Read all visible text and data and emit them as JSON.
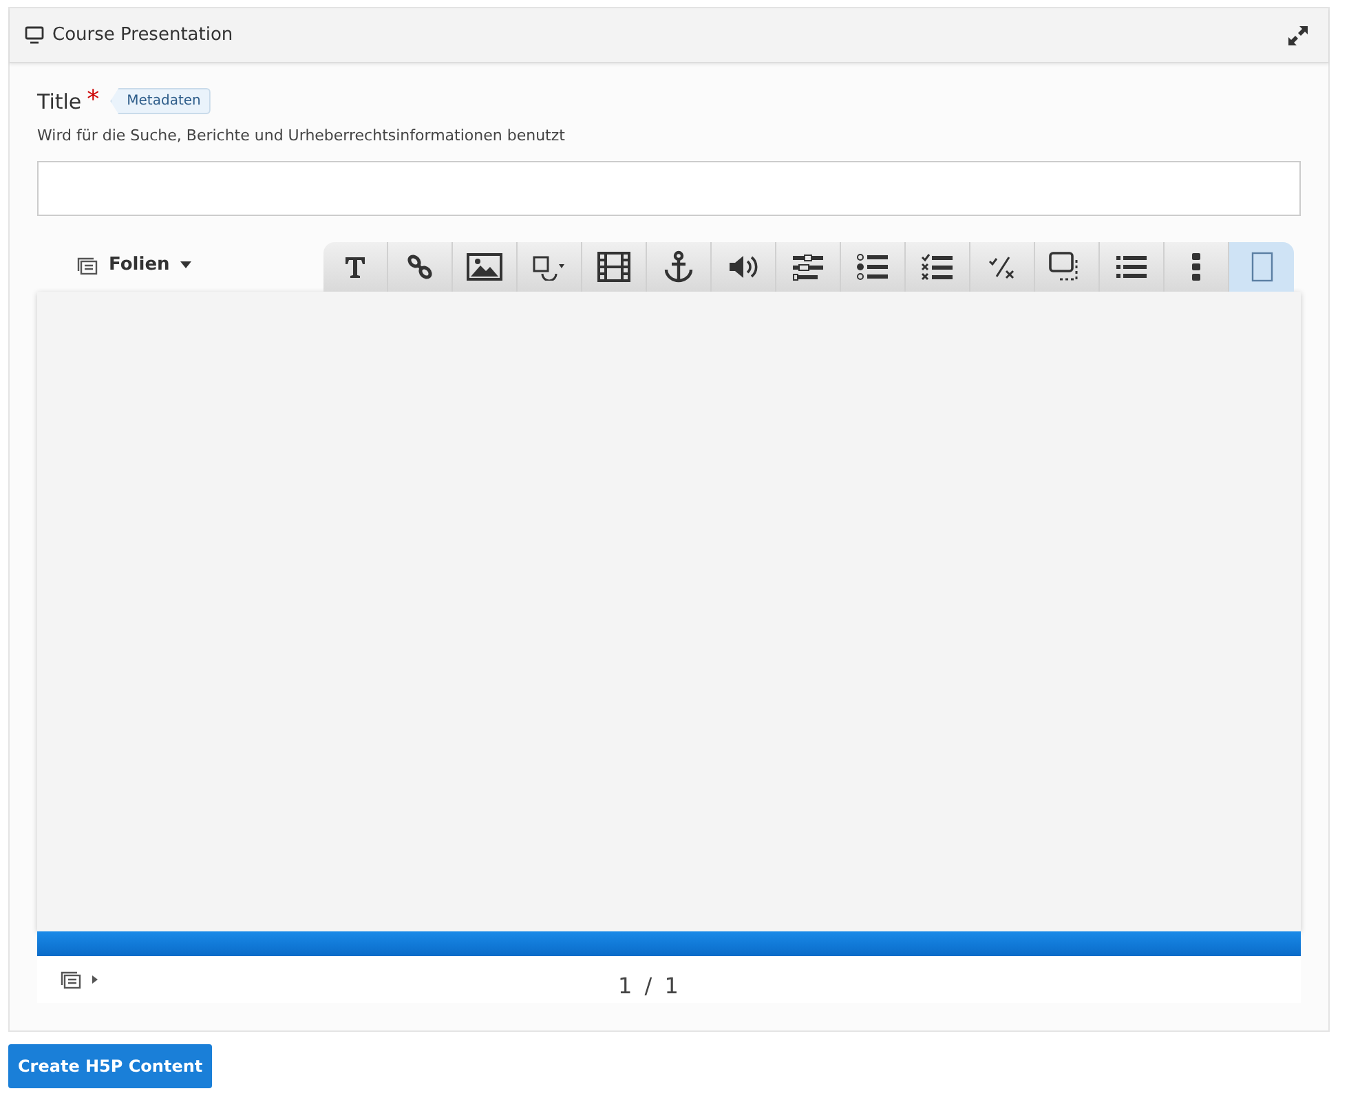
{
  "panel": {
    "title": "Course Presentation"
  },
  "field": {
    "label": "Title",
    "required_mark": "*",
    "metadata_button": "Metadaten",
    "description": "Wird für die Suche, Berichte und Urheberrechtsinformationen benutzt"
  },
  "slides_menu": {
    "label": "Folien"
  },
  "toolbar": [
    {
      "selected": false
    },
    {
      "selected": false
    },
    {
      "selected": false
    },
    {
      "selected": false
    },
    {
      "selected": false
    },
    {
      "selected": false
    },
    {
      "selected": false
    },
    {
      "selected": false
    },
    {
      "selected": false
    },
    {
      "selected": false
    },
    {
      "selected": false
    },
    {
      "selected": false
    },
    {
      "selected": false
    },
    {
      "selected": false
    },
    {
      "selected": true
    }
  ],
  "progress_bar": {
    "level": 1
  },
  "footer": {
    "progress": "1 / 1"
  },
  "submit_button": "Create H5P Content"
}
